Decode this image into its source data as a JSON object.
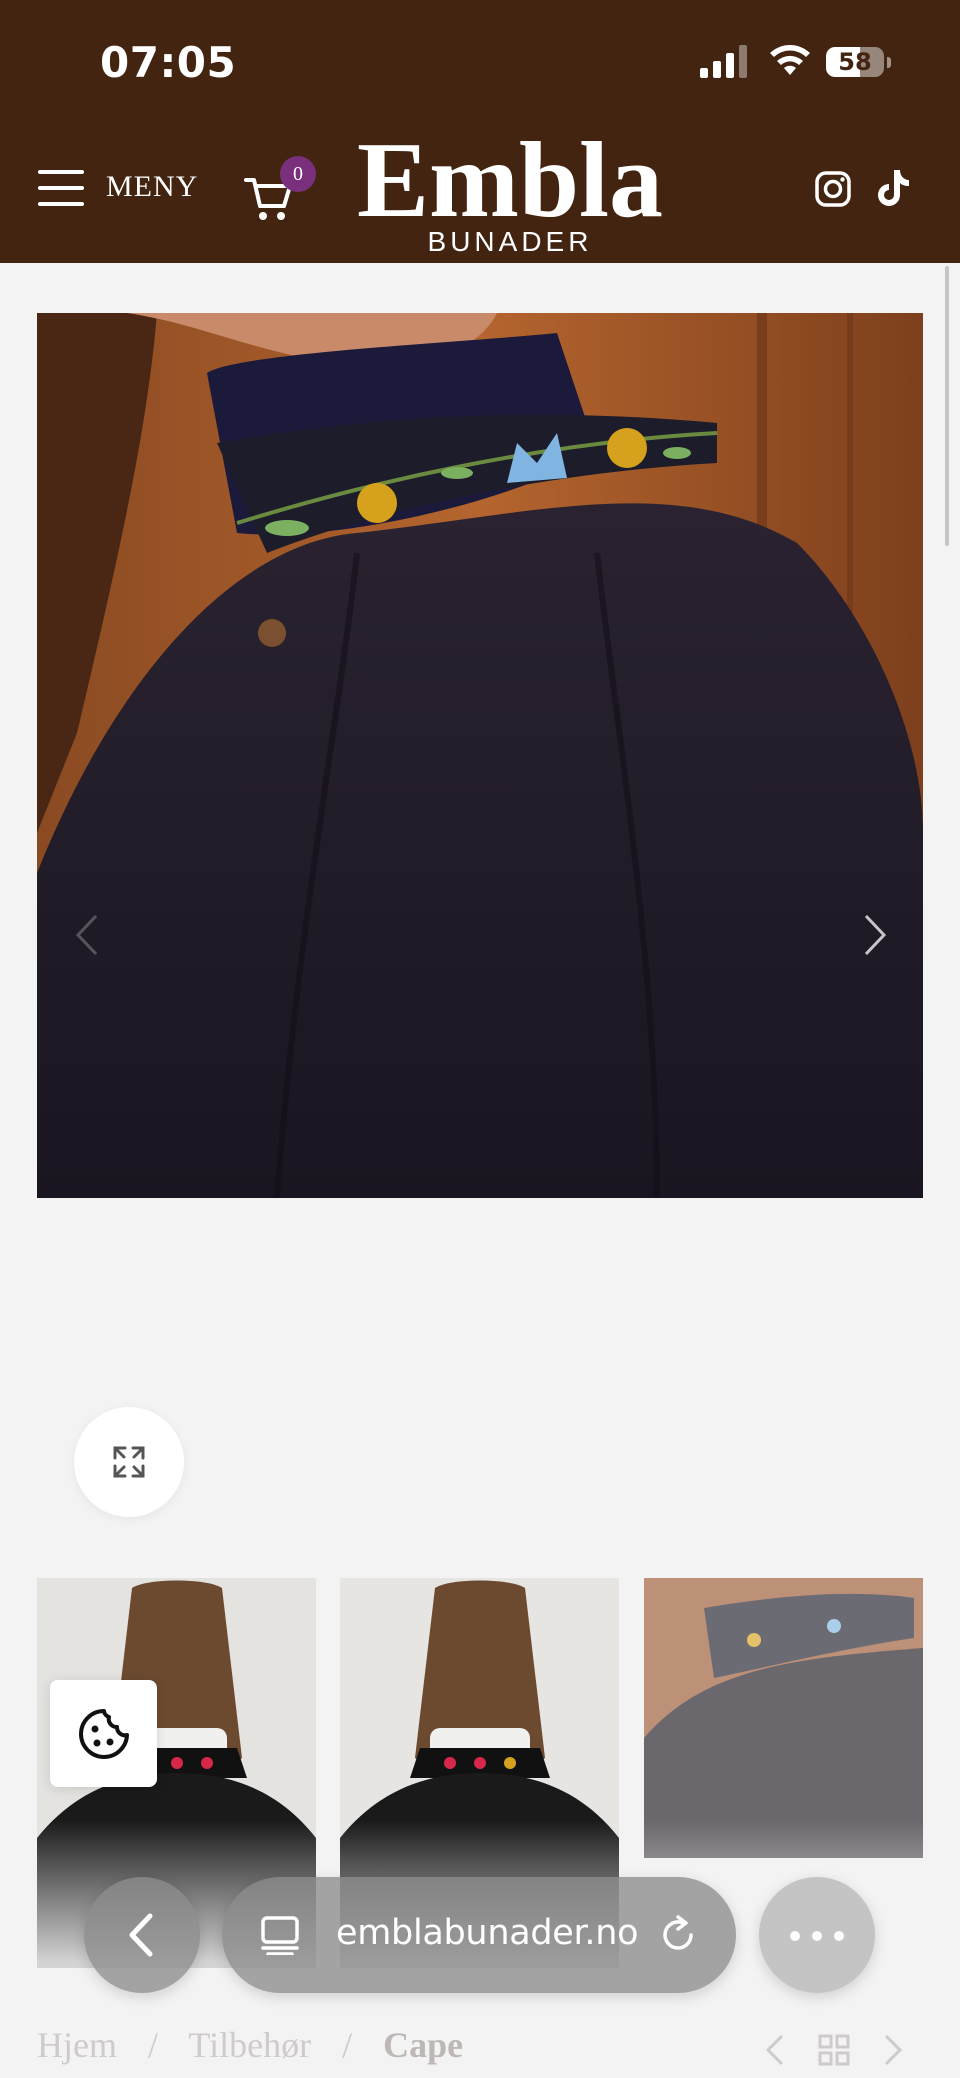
{
  "status_bar": {
    "time": "07:05",
    "battery": "58",
    "battery_level": 0.58
  },
  "header": {
    "menu_label": "MENY",
    "cart_count": "0",
    "logo_name": "Embla",
    "logo_sub": "BUNADER",
    "icons": [
      "hamburger-icon",
      "cart-icon",
      "instagram-icon",
      "tiktok-icon"
    ]
  },
  "gallery": {
    "main_image": "cape-collar-embroidery",
    "thumbnails": [
      "cape-back-view",
      "cape-back-view-2",
      "cape-collar-side"
    ]
  },
  "breadcrumb": {
    "items": [
      "Hjem",
      "Tilbehør",
      "Cape"
    ],
    "separator": "/"
  },
  "browser": {
    "url": "emblabunader.no"
  },
  "colors": {
    "brand_brown": "#422410",
    "badge_purple": "#7a2f7c",
    "background": "#f4f3f3"
  }
}
